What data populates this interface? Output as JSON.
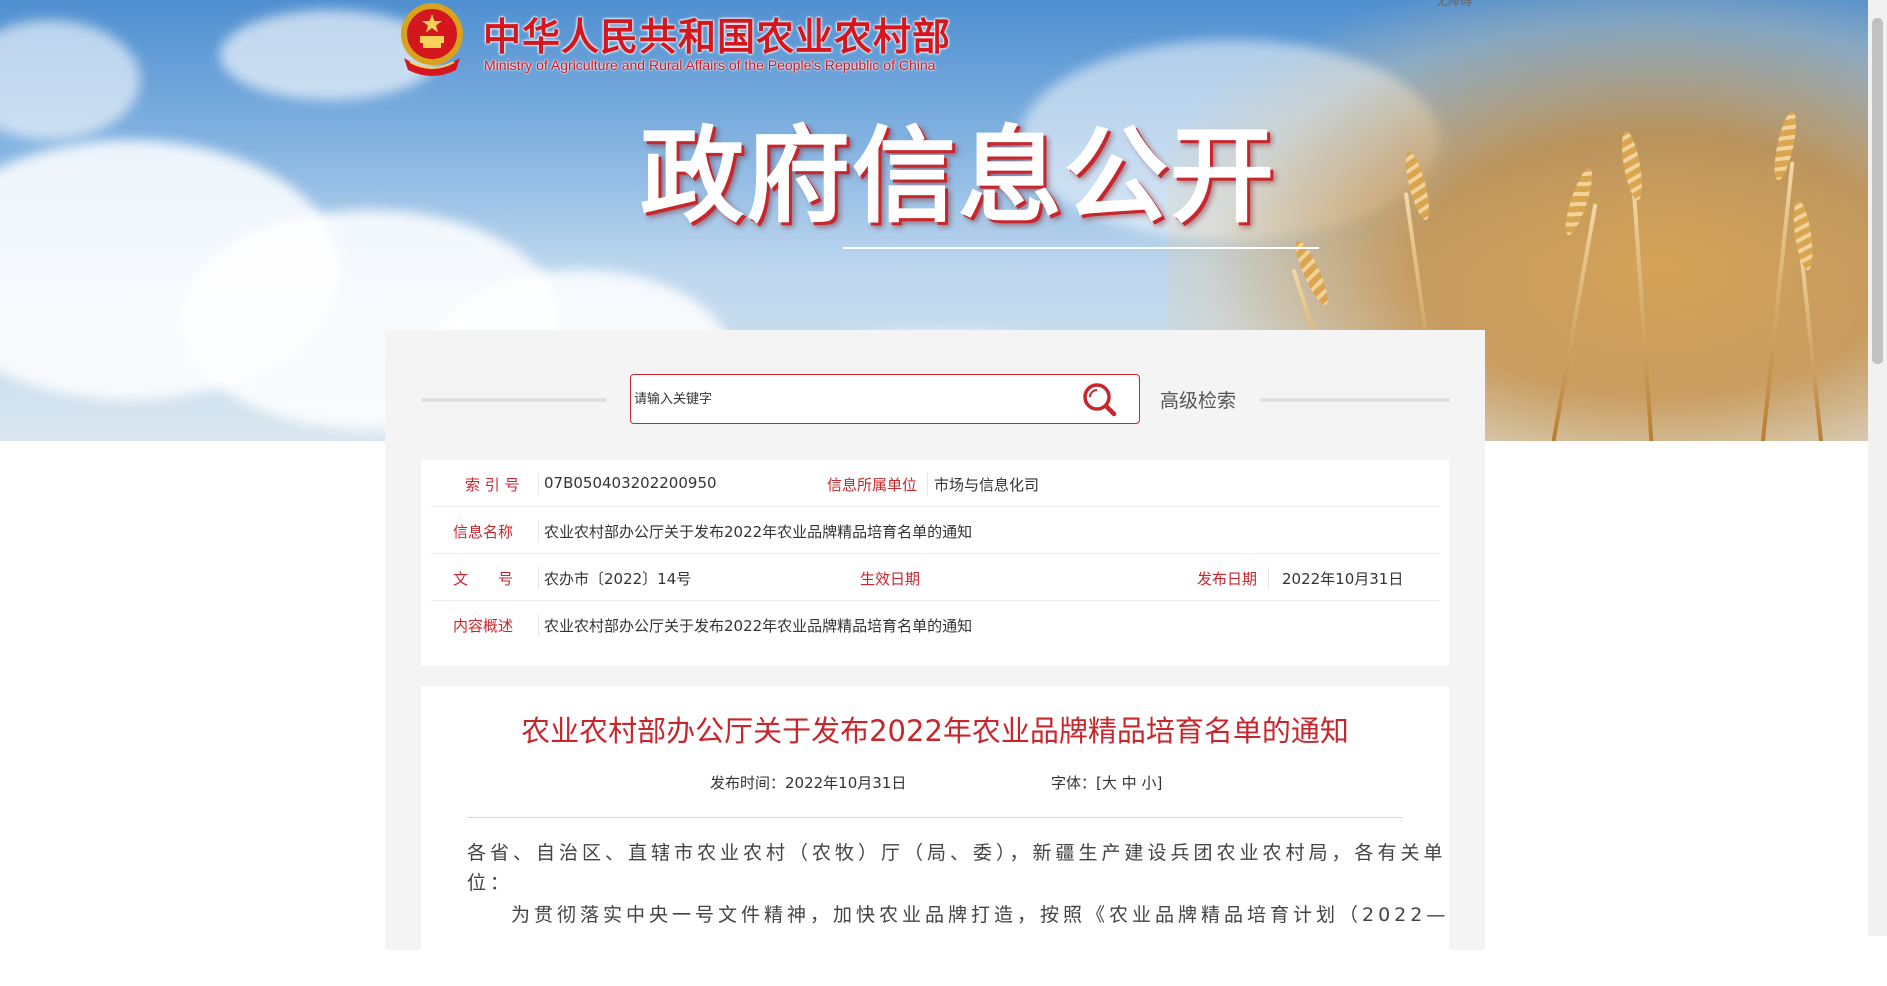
{
  "header": {
    "site_title_cn": "中华人民共和国农业农村部",
    "site_title_en": "Ministry of Agriculture and Rural Affairs of the People's Republic of China",
    "top_link": "无障碍",
    "page_heading": "政府信息公开",
    "logo_icon": "national-emblem-icon"
  },
  "search": {
    "placeholder": "请输入关键字",
    "button_icon": "search-icon",
    "advanced_label": "高级检索"
  },
  "info": {
    "index_label": "索 引 号",
    "index_value": "07B050403202200950",
    "unit_label": "信息所属单位",
    "unit_value": "市场与信息化司",
    "name_label": "信息名称",
    "name_value": "农业农村部办公厅关于发布2022年农业品牌精品培育名单的通知",
    "doc_label": "文　　号",
    "doc_value": "农办市〔2022〕14号",
    "effective_label": "生效日期",
    "effective_value": "",
    "publish_label": "发布日期",
    "publish_value": "2022年10月31日",
    "summary_label": "内容概述",
    "summary_value": "农业农村部办公厅关于发布2022年农业品牌精品培育名单的通知"
  },
  "article": {
    "title": "农业农村部办公厅关于发布2022年农业品牌精品培育名单的通知",
    "pub_time_label": "发布时间：",
    "pub_time_value": "2022年10月31日",
    "font_size_label": "字体：",
    "font_open": "[",
    "font_large": "大",
    "font_medium": "中",
    "font_small": "小",
    "font_close": "]",
    "para1_line1": "各省、自治区、直辖市农业农村（农牧）厅（局、委），新疆生产建设兵团农业农村局，各有关单",
    "para1_line2": "位：",
    "para2_line1": "为贯彻落实中央一号文件精神，加快农业品牌打造，按照《农业品牌精品培育计划（2022—"
  },
  "colors": {
    "accent_red": "#c8262d",
    "title_red": "#d4161e",
    "panel_bg": "#f4f4f4"
  }
}
